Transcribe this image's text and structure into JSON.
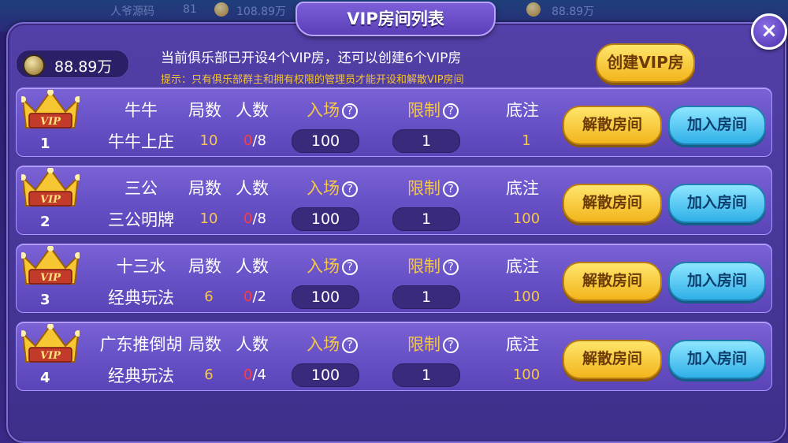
{
  "background": {
    "left_text": "人爷源码",
    "left_num": "81",
    "mid_balance": "108.89万",
    "right_balance": "88.89万"
  },
  "dialog": {
    "title": "VIP房间列表",
    "close_label": "×",
    "balance": "88.89万",
    "info": "当前俱乐部已开设4个VIP房，还可以创建6个VIP房",
    "hint": "提示：只有俱乐部群主和拥有权限的管理员才能开设和解散VIP房间",
    "create_button": "创建VIP房"
  },
  "columns": {
    "rounds": "局数",
    "players": "人数",
    "entry": "入场",
    "limit": "限制",
    "base": "底注",
    "help": "?"
  },
  "buttons": {
    "dissolve": "解散房间",
    "join": "加入房间"
  },
  "rooms": [
    {
      "num": "1",
      "game": "牛牛",
      "mode": "牛牛上庄",
      "rounds": "10",
      "players_current": "0",
      "players_max": "/8",
      "entry": "100",
      "limit": "1",
      "base": "1"
    },
    {
      "num": "2",
      "game": "三公",
      "mode": "三公明牌",
      "rounds": "10",
      "players_current": "0",
      "players_max": "/8",
      "entry": "100",
      "limit": "1",
      "base": "100"
    },
    {
      "num": "3",
      "game": "十三水",
      "mode": "经典玩法",
      "rounds": "6",
      "players_current": "0",
      "players_max": "/2",
      "entry": "100",
      "limit": "1",
      "base": "100"
    },
    {
      "num": "4",
      "game": "广东推倒胡",
      "mode": "经典玩法",
      "rounds": "6",
      "players_current": "0",
      "players_max": "/4",
      "entry": "100",
      "limit": "1",
      "base": "100"
    }
  ],
  "colors": {
    "accent_gold": "#f5c84a",
    "player_current": "#ff3b3b",
    "panel": "#4a3a9c"
  },
  "icons": {
    "crown": "vip-crown-icon",
    "coin": "gold-coin-icon",
    "help": "question-mark-icon",
    "close": "close-icon"
  }
}
